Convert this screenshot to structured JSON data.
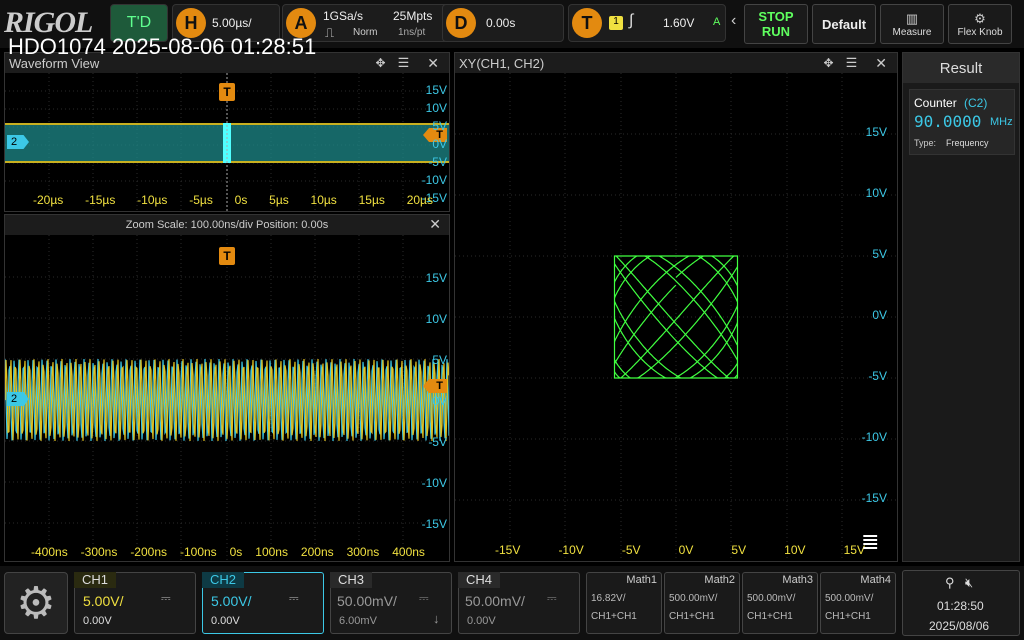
{
  "brand": "RIGOL",
  "model_time": "HDO1074 2025-08-06 01:28:51",
  "top": {
    "trigger_status": "T'D",
    "h_label": "H",
    "h_scale": "5.00µs/",
    "a_label": "A",
    "sample_rate": "1GSa/s",
    "mode": "Norm",
    "mem_depth": "25Mpts",
    "time_per_pt": "1ns/pt",
    "d_label": "D",
    "delay": "0.00s",
    "t_label": "T",
    "trig_source": "1",
    "trig_level": "1.60V",
    "trig_mode": "A",
    "stop": "STOP",
    "run": "RUN",
    "default": "Default",
    "measure": "Measure",
    "flex": "Flex Knob"
  },
  "waveform_view": {
    "title": "Waveform View",
    "y_labels": [
      "15V",
      "10V",
      "5V",
      "0V",
      "-5V",
      "-10V",
      "-15V"
    ],
    "x_labels": [
      "-20µs",
      "-15µs",
      "-10µs",
      "-5µs",
      "0s",
      "5µs",
      "10µs",
      "15µs",
      "20µs"
    ],
    "ch_marker": "2",
    "t_marker": "T"
  },
  "zoom_view": {
    "title": "Zoom   Scale: 100.00ns/div   Position: 0.00s",
    "y_labels": [
      "15V",
      "10V",
      "5V",
      "0V",
      "-5V",
      "-10V",
      "-15V"
    ],
    "x_labels": [
      "-400ns",
      "-300ns",
      "-200ns",
      "-100ns",
      "0s",
      "100ns",
      "200ns",
      "300ns",
      "400ns"
    ],
    "ch_marker": "2",
    "t_marker": "T"
  },
  "xy_view": {
    "title": "XY(CH1, CH2)",
    "y_labels": [
      "15V",
      "10V",
      "5V",
      "0V",
      "-5V",
      "-10V",
      "-15V"
    ],
    "x_labels": [
      "-15V",
      "-10V",
      "-5V",
      "0V",
      "5V",
      "10V",
      "15V"
    ]
  },
  "result": {
    "title": "Result",
    "counter_label": "Counter",
    "counter_src": "(C2)",
    "counter_value": "90.0000",
    "counter_unit": "MHz",
    "type_label": "Type:",
    "type_value": "Frequency"
  },
  "channels": [
    {
      "name": "CH1",
      "scale": "5.00V/",
      "offset": "0.00V",
      "color": "#f0e040"
    },
    {
      "name": "CH2",
      "scale": "5.00V/",
      "offset": "0.00V",
      "color": "#3cc8e6"
    },
    {
      "name": "CH3",
      "scale": "50.00mV/",
      "offset": "6.00mV",
      "color": "#999999"
    },
    {
      "name": "CH4",
      "scale": "50.00mV/",
      "offset": "0.00V",
      "color": "#999999"
    }
  ],
  "maths": [
    {
      "name": "Math1",
      "scale": "16.82V/",
      "expr": "CH1+CH1"
    },
    {
      "name": "Math2",
      "scale": "500.00mV/",
      "expr": "CH1+CH1"
    },
    {
      "name": "Math3",
      "scale": "500.00mV/",
      "expr": "CH1+CH1"
    },
    {
      "name": "Math4",
      "scale": "500.00mV/",
      "expr": "CH1+CH1"
    }
  ],
  "clock": {
    "time": "01:28:50",
    "date": "2025/08/06"
  },
  "colors": {
    "ch1": "#f0e040",
    "ch2": "#3cc8e6",
    "xy": "#40ff40",
    "trigger": "#e38a10"
  }
}
